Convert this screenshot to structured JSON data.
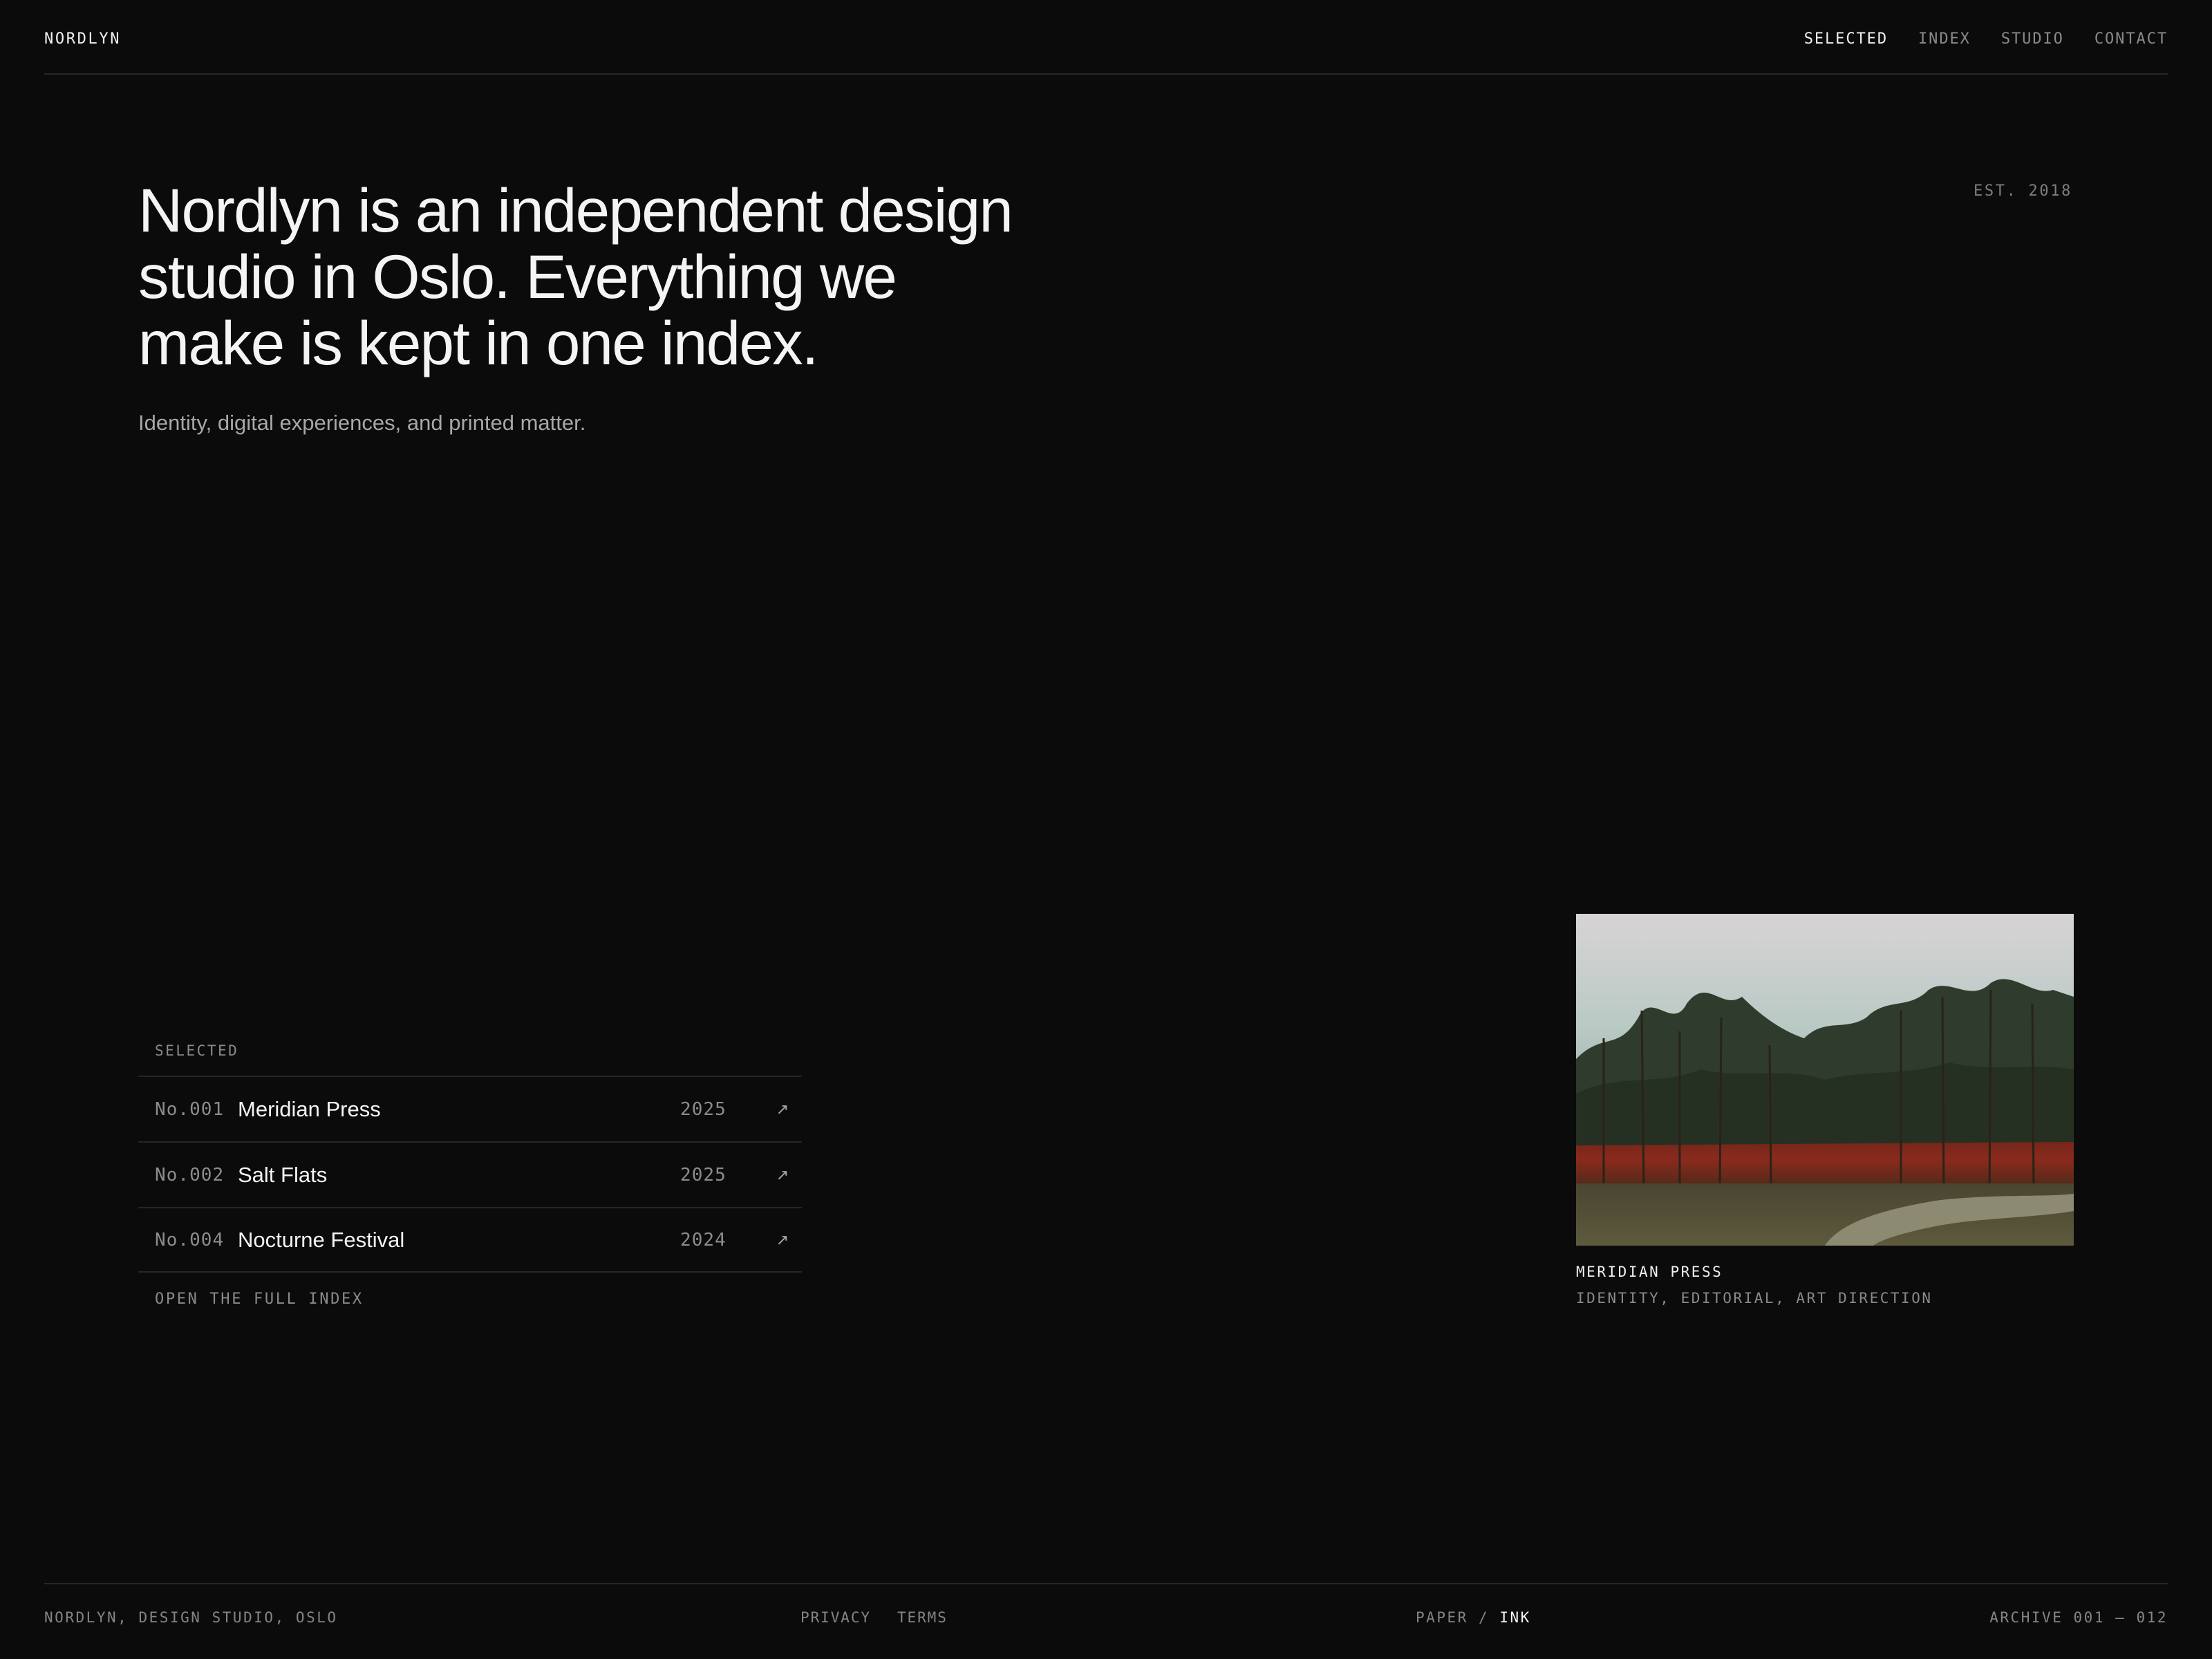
{
  "header": {
    "logo": "NORDLYN",
    "nav": [
      {
        "label": "SELECTED",
        "active": true
      },
      {
        "label": "INDEX",
        "active": false
      },
      {
        "label": "STUDIO",
        "active": false
      },
      {
        "label": "CONTACT",
        "active": false
      }
    ]
  },
  "hero": {
    "title": "Nordlyn is an independent design studio in Oslo. Everything we make is kept in one index.",
    "subtitle": "Identity, digital experiences, and printed matter.",
    "established": "EST. 2018"
  },
  "selected": {
    "label": "SELECTED",
    "rows": [
      {
        "number": "No.001",
        "name": "Meridian Press",
        "year": "2025",
        "arrow": "↗"
      },
      {
        "number": "No.002",
        "name": "Salt Flats",
        "year": "2025",
        "arrow": "↗"
      },
      {
        "number": "No.004",
        "name": "Nocturne Festival",
        "year": "2024",
        "arrow": "↗"
      }
    ],
    "open_index": "OPEN THE FULL INDEX"
  },
  "feature": {
    "title": "MERIDIAN PRESS",
    "tags": "IDENTITY, EDITORIAL, ART DIRECTION"
  },
  "footer": {
    "studio": "NORDLYN, DESIGN STUDIO, OSLO",
    "links": [
      "PRIVACY",
      "TERMS"
    ],
    "theme": {
      "paper": "PAPER",
      "separator": "/",
      "ink": "INK",
      "active": "INK"
    },
    "archive": "ARCHIVE 001 – 012"
  },
  "colors": {
    "background": "#0b0b0b",
    "text": "#f4f4f4",
    "muted": "#8a8a8a",
    "rule": "#262626"
  }
}
